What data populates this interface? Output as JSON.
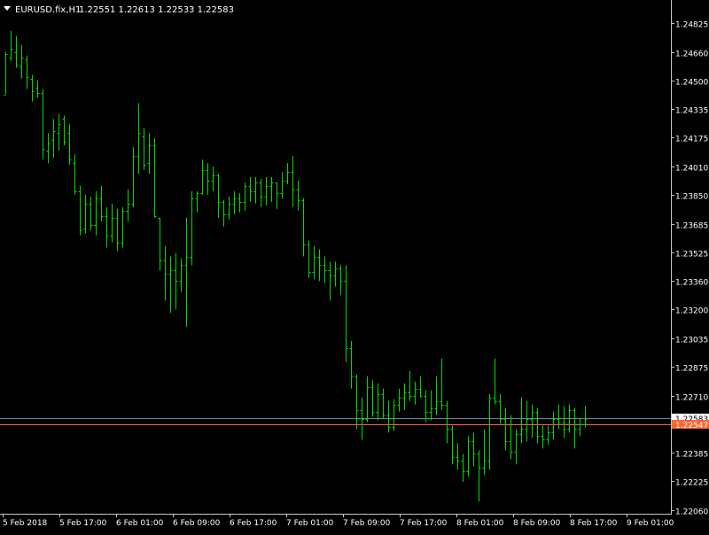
{
  "header": {
    "symbol": "EURUSD.fix,H1",
    "ohlc": "1.22551 1.22613 1.22533 1.22583"
  },
  "colors": {
    "background": "#000000",
    "bars": "#00dc00",
    "axis_text": "#ffffff",
    "frame": "#c8c8c8",
    "bid_line": "#6e7da0",
    "ask_line": "#ff6633"
  },
  "chart_data": {
    "type": "ohlc-bar",
    "timeframe": "H1",
    "ylim": [
      1.2206,
      1.2488
    ],
    "y_ticks": [
      "1.24825",
      "1.24660",
      "1.24500",
      "1.24335",
      "1.24175",
      "1.24010",
      "1.23850",
      "1.23685",
      "1.23525",
      "1.23360",
      "1.23200",
      "1.23035",
      "1.22875",
      "1.22710",
      "1.22385",
      "1.22225",
      "1.22060"
    ],
    "x_ticks": [
      "5 Feb 2018",
      "5 Feb 17:00",
      "6 Feb 01:00",
      "6 Feb 09:00",
      "6 Feb 17:00",
      "7 Feb 01:00",
      "7 Feb 09:00",
      "7 Feb 17:00",
      "8 Feb 01:00",
      "8 Feb 09:00",
      "8 Feb 17:00",
      "9 Feb 01:00"
    ],
    "price_lines": [
      {
        "name": "bid",
        "value": 1.22583,
        "label": "1.22583",
        "color": "#6e7da0",
        "label_bg": "#ffffff",
        "label_fg": "#000000"
      },
      {
        "name": "ask",
        "value": 1.22547,
        "label": "1.22547",
        "color": "#ff6633",
        "label_bg": "#ff6633",
        "label_fg": "#ffffff"
      }
    ],
    "bars": [
      {
        "o": 1.2442,
        "h": 1.2466,
        "l": 1.2442,
        "c": 1.2465
      },
      {
        "o": 1.2463,
        "h": 1.2478,
        "l": 1.2461,
        "c": 1.2468
      },
      {
        "o": 1.2466,
        "h": 1.2475,
        "l": 1.2457,
        "c": 1.2459
      },
      {
        "o": 1.2458,
        "h": 1.247,
        "l": 1.2451,
        "c": 1.2463
      },
      {
        "o": 1.2462,
        "h": 1.2464,
        "l": 1.2445,
        "c": 1.2452
      },
      {
        "o": 1.2451,
        "h": 1.2453,
        "l": 1.2438,
        "c": 1.2444
      },
      {
        "o": 1.2446,
        "h": 1.245,
        "l": 1.244,
        "c": 1.2443
      },
      {
        "o": 1.2443,
        "h": 1.2445,
        "l": 1.2405,
        "c": 1.2411
      },
      {
        "o": 1.241,
        "h": 1.242,
        "l": 1.2403,
        "c": 1.2414
      },
      {
        "o": 1.2416,
        "h": 1.2428,
        "l": 1.2406,
        "c": 1.2421
      },
      {
        "o": 1.242,
        "h": 1.2431,
        "l": 1.241,
        "c": 1.2425
      },
      {
        "o": 1.2428,
        "h": 1.243,
        "l": 1.2413,
        "c": 1.2415
      },
      {
        "o": 1.242,
        "h": 1.2425,
        "l": 1.2402,
        "c": 1.2405
      },
      {
        "o": 1.2403,
        "h": 1.2408,
        "l": 1.2385,
        "c": 1.2387
      },
      {
        "o": 1.2387,
        "h": 1.239,
        "l": 1.2362,
        "c": 1.2365
      },
      {
        "o": 1.2366,
        "h": 1.2385,
        "l": 1.2363,
        "c": 1.238
      },
      {
        "o": 1.238,
        "h": 1.2384,
        "l": 1.2365,
        "c": 1.2368
      },
      {
        "o": 1.2368,
        "h": 1.2387,
        "l": 1.2362,
        "c": 1.2383
      },
      {
        "o": 1.2383,
        "h": 1.239,
        "l": 1.237,
        "c": 1.2373
      },
      {
        "o": 1.2373,
        "h": 1.2378,
        "l": 1.2355,
        "c": 1.2362
      },
      {
        "o": 1.2362,
        "h": 1.238,
        "l": 1.2358,
        "c": 1.2372
      },
      {
        "o": 1.2372,
        "h": 1.2377,
        "l": 1.2353,
        "c": 1.2358
      },
      {
        "o": 1.2358,
        "h": 1.2378,
        "l": 1.2355,
        "c": 1.2376
      },
      {
        "o": 1.2376,
        "h": 1.2388,
        "l": 1.237,
        "c": 1.238
      },
      {
        "o": 1.238,
        "h": 1.2412,
        "l": 1.2378,
        "c": 1.2407
      },
      {
        "o": 1.2407,
        "h": 1.2437,
        "l": 1.2397,
        "c": 1.242
      },
      {
        "o": 1.2418,
        "h": 1.2423,
        "l": 1.2399,
        "c": 1.2402
      },
      {
        "o": 1.2403,
        "h": 1.242,
        "l": 1.2397,
        "c": 1.2413
      },
      {
        "o": 1.2413,
        "h": 1.2417,
        "l": 1.2372,
        "c": 1.2373
      },
      {
        "o": 1.2372,
        "h": 1.2372,
        "l": 1.2342,
        "c": 1.2348
      },
      {
        "o": 1.2348,
        "h": 1.2356,
        "l": 1.2325,
        "c": 1.234
      },
      {
        "o": 1.234,
        "h": 1.235,
        "l": 1.2318,
        "c": 1.2342
      },
      {
        "o": 1.2342,
        "h": 1.2352,
        "l": 1.232,
        "c": 1.2336
      },
      {
        "o": 1.2336,
        "h": 1.2349,
        "l": 1.233,
        "c": 1.2345
      },
      {
        "o": 1.2345,
        "h": 1.2372,
        "l": 1.231,
        "c": 1.235
      },
      {
        "o": 1.235,
        "h": 1.2387,
        "l": 1.2345,
        "c": 1.2383
      },
      {
        "o": 1.2383,
        "h": 1.2387,
        "l": 1.2375,
        "c": 1.2386
      },
      {
        "o": 1.2386,
        "h": 1.2405,
        "l": 1.2385,
        "c": 1.2399
      },
      {
        "o": 1.2399,
        "h": 1.2403,
        "l": 1.2385,
        "c": 1.2393
      },
      {
        "o": 1.2393,
        "h": 1.2401,
        "l": 1.2387,
        "c": 1.2396
      },
      {
        "o": 1.2396,
        "h": 1.2397,
        "l": 1.2372,
        "c": 1.2381
      },
      {
        "o": 1.2381,
        "h": 1.2382,
        "l": 1.2367,
        "c": 1.2374
      },
      {
        "o": 1.2374,
        "h": 1.2384,
        "l": 1.2371,
        "c": 1.238
      },
      {
        "o": 1.238,
        "h": 1.2387,
        "l": 1.2374,
        "c": 1.2383
      },
      {
        "o": 1.2383,
        "h": 1.2386,
        "l": 1.2375,
        "c": 1.2381
      },
      {
        "o": 1.2381,
        "h": 1.2392,
        "l": 1.2376,
        "c": 1.239
      },
      {
        "o": 1.239,
        "h": 1.2395,
        "l": 1.2381,
        "c": 1.2387
      },
      {
        "o": 1.2387,
        "h": 1.2395,
        "l": 1.238,
        "c": 1.2392
      },
      {
        "o": 1.2392,
        "h": 1.2394,
        "l": 1.2378,
        "c": 1.2384
      },
      {
        "o": 1.2384,
        "h": 1.2395,
        "l": 1.2379,
        "c": 1.239
      },
      {
        "o": 1.239,
        "h": 1.2395,
        "l": 1.2381,
        "c": 1.2392
      },
      {
        "o": 1.2392,
        "h": 1.2392,
        "l": 1.2377,
        "c": 1.2386
      },
      {
        "o": 1.2386,
        "h": 1.2398,
        "l": 1.2383,
        "c": 1.2393
      },
      {
        "o": 1.2393,
        "h": 1.2403,
        "l": 1.2391,
        "c": 1.2398
      },
      {
        "o": 1.2398,
        "h": 1.2407,
        "l": 1.2378,
        "c": 1.2388
      },
      {
        "o": 1.2388,
        "h": 1.2393,
        "l": 1.2376,
        "c": 1.2382
      },
      {
        "o": 1.2382,
        "h": 1.2383,
        "l": 1.235,
        "c": 1.2357
      },
      {
        "o": 1.2357,
        "h": 1.2359,
        "l": 1.2338,
        "c": 1.2341
      },
      {
        "o": 1.2341,
        "h": 1.2356,
        "l": 1.2337,
        "c": 1.235
      },
      {
        "o": 1.235,
        "h": 1.2354,
        "l": 1.2336,
        "c": 1.2345
      },
      {
        "o": 1.2345,
        "h": 1.235,
        "l": 1.2335,
        "c": 1.2342
      },
      {
        "o": 1.2342,
        "h": 1.2347,
        "l": 1.2325,
        "c": 1.2339
      },
      {
        "o": 1.2339,
        "h": 1.2347,
        "l": 1.2333,
        "c": 1.2343
      },
      {
        "o": 1.2343,
        "h": 1.2345,
        "l": 1.2328,
        "c": 1.2336
      },
      {
        "o": 1.2336,
        "h": 1.2345,
        "l": 1.229,
        "c": 1.2298
      },
      {
        "o": 1.2298,
        "h": 1.2302,
        "l": 1.2275,
        "c": 1.2282
      },
      {
        "o": 1.2282,
        "h": 1.2283,
        "l": 1.2252,
        "c": 1.2263
      },
      {
        "o": 1.2263,
        "h": 1.227,
        "l": 1.2246,
        "c": 1.2258
      },
      {
        "o": 1.2258,
        "h": 1.2282,
        "l": 1.2256,
        "c": 1.2276
      },
      {
        "o": 1.2276,
        "h": 1.228,
        "l": 1.2259,
        "c": 1.2262
      },
      {
        "o": 1.2262,
        "h": 1.2278,
        "l": 1.2257,
        "c": 1.2272
      },
      {
        "o": 1.2272,
        "h": 1.2275,
        "l": 1.2258,
        "c": 1.226
      },
      {
        "o": 1.226,
        "h": 1.2268,
        "l": 1.225,
        "c": 1.2253
      },
      {
        "o": 1.2253,
        "h": 1.2269,
        "l": 1.2251,
        "c": 1.2266
      },
      {
        "o": 1.2266,
        "h": 1.2275,
        "l": 1.2262,
        "c": 1.227
      },
      {
        "o": 1.227,
        "h": 1.2278,
        "l": 1.2263,
        "c": 1.2273
      },
      {
        "o": 1.2273,
        "h": 1.2285,
        "l": 1.2268,
        "c": 1.2271
      },
      {
        "o": 1.2271,
        "h": 1.2279,
        "l": 1.2266,
        "c": 1.2275
      },
      {
        "o": 1.2275,
        "h": 1.2282,
        "l": 1.227,
        "c": 1.2271
      },
      {
        "o": 1.2271,
        "h": 1.2274,
        "l": 1.2256,
        "c": 1.2262
      },
      {
        "o": 1.2262,
        "h": 1.2274,
        "l": 1.2257,
        "c": 1.2264
      },
      {
        "o": 1.2264,
        "h": 1.2282,
        "l": 1.226,
        "c": 1.2268
      },
      {
        "o": 1.2268,
        "h": 1.2292,
        "l": 1.2263,
        "c": 1.2266
      },
      {
        "o": 1.2266,
        "h": 1.2268,
        "l": 1.2244,
        "c": 1.2252
      },
      {
        "o": 1.2252,
        "h": 1.2254,
        "l": 1.2232,
        "c": 1.2236
      },
      {
        "o": 1.2236,
        "h": 1.2244,
        "l": 1.2229,
        "c": 1.2234
      },
      {
        "o": 1.2234,
        "h": 1.2238,
        "l": 1.2222,
        "c": 1.2228
      },
      {
        "o": 1.2228,
        "h": 1.2248,
        "l": 1.2225,
        "c": 1.2245
      },
      {
        "o": 1.2245,
        "h": 1.225,
        "l": 1.2231,
        "c": 1.2238
      },
      {
        "o": 1.2238,
        "h": 1.224,
        "l": 1.2211,
        "c": 1.223
      },
      {
        "o": 1.223,
        "h": 1.2252,
        "l": 1.2226,
        "c": 1.2234
      },
      {
        "o": 1.2234,
        "h": 1.2272,
        "l": 1.2229,
        "c": 1.227
      },
      {
        "o": 1.227,
        "h": 1.2292,
        "l": 1.2266,
        "c": 1.2268
      },
      {
        "o": 1.2268,
        "h": 1.2272,
        "l": 1.2255,
        "c": 1.2258
      },
      {
        "o": 1.2258,
        "h": 1.2264,
        "l": 1.224,
        "c": 1.2245
      },
      {
        "o": 1.2245,
        "h": 1.226,
        "l": 1.2235,
        "c": 1.2239
      },
      {
        "o": 1.2239,
        "h": 1.2252,
        "l": 1.2232,
        "c": 1.2249
      },
      {
        "o": 1.2249,
        "h": 1.227,
        "l": 1.2244,
        "c": 1.2252
      },
      {
        "o": 1.2252,
        "h": 1.2268,
        "l": 1.2245,
        "c": 1.2258
      },
      {
        "o": 1.2258,
        "h": 1.2266,
        "l": 1.2247,
        "c": 1.2262
      },
      {
        "o": 1.2262,
        "h": 1.2264,
        "l": 1.2244,
        "c": 1.2248
      },
      {
        "o": 1.2248,
        "h": 1.2254,
        "l": 1.2241,
        "c": 1.2246
      },
      {
        "o": 1.2246,
        "h": 1.2254,
        "l": 1.2243,
        "c": 1.225
      },
      {
        "o": 1.225,
        "h": 1.2262,
        "l": 1.2246,
        "c": 1.2258
      },
      {
        "o": 1.2258,
        "h": 1.2266,
        "l": 1.2252,
        "c": 1.2256
      },
      {
        "o": 1.2256,
        "h": 1.2265,
        "l": 1.2247,
        "c": 1.2252
      },
      {
        "o": 1.2252,
        "h": 1.2266,
        "l": 1.225,
        "c": 1.2263
      },
      {
        "o": 1.2263,
        "h": 1.2264,
        "l": 1.2241,
        "c": 1.2252
      },
      {
        "o": 1.2252,
        "h": 1.2258,
        "l": 1.2248,
        "c": 1.2255
      },
      {
        "o": 1.2255,
        "h": 1.2265,
        "l": 1.2253,
        "c": 1.2258
      }
    ]
  }
}
